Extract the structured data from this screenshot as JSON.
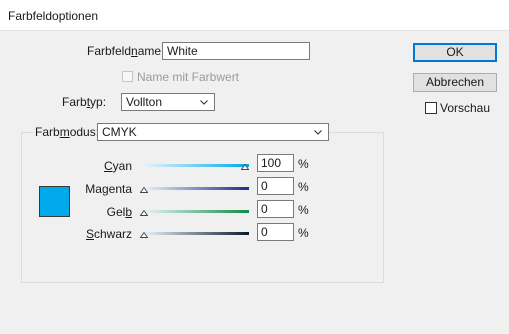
{
  "window": {
    "title": "Farbfeldoptionen"
  },
  "form": {
    "name_label": {
      "pre": "Farbfeld",
      "acc": "n",
      "post": "ame:"
    },
    "name_value": "White",
    "name_with_color_label": "Name mit Farbwert",
    "type_label": {
      "pre": "Farb",
      "acc": "t",
      "post": "yp:"
    },
    "type_value": "Vollton",
    "mode_label": {
      "pre": "Farb",
      "acc": "m",
      "post": "odus:"
    },
    "mode_value": "CMYK"
  },
  "buttons": {
    "ok": "OK",
    "cancel": "Abbrechen"
  },
  "preview_label": "Vorschau",
  "swatch_color": "#00a9ea",
  "channels": [
    {
      "pre": "",
      "acc": "C",
      "post": "yan",
      "value": "100",
      "unit": "%",
      "level": 1.0,
      "color": "#00a9ea"
    },
    {
      "pre": "Ma",
      "acc": "g",
      "post": "enta",
      "value": "0",
      "unit": "%",
      "level": 0.0,
      "color": "#1d2e8c"
    },
    {
      "pre": "Gel",
      "acc": "b",
      "post": "",
      "value": "0",
      "unit": "%",
      "level": 0.0,
      "color": "#138a47"
    },
    {
      "pre": "",
      "acc": "S",
      "post": "chwarz",
      "value": "0",
      "unit": "%",
      "level": 0.0,
      "color": "#0d1a2a"
    }
  ]
}
